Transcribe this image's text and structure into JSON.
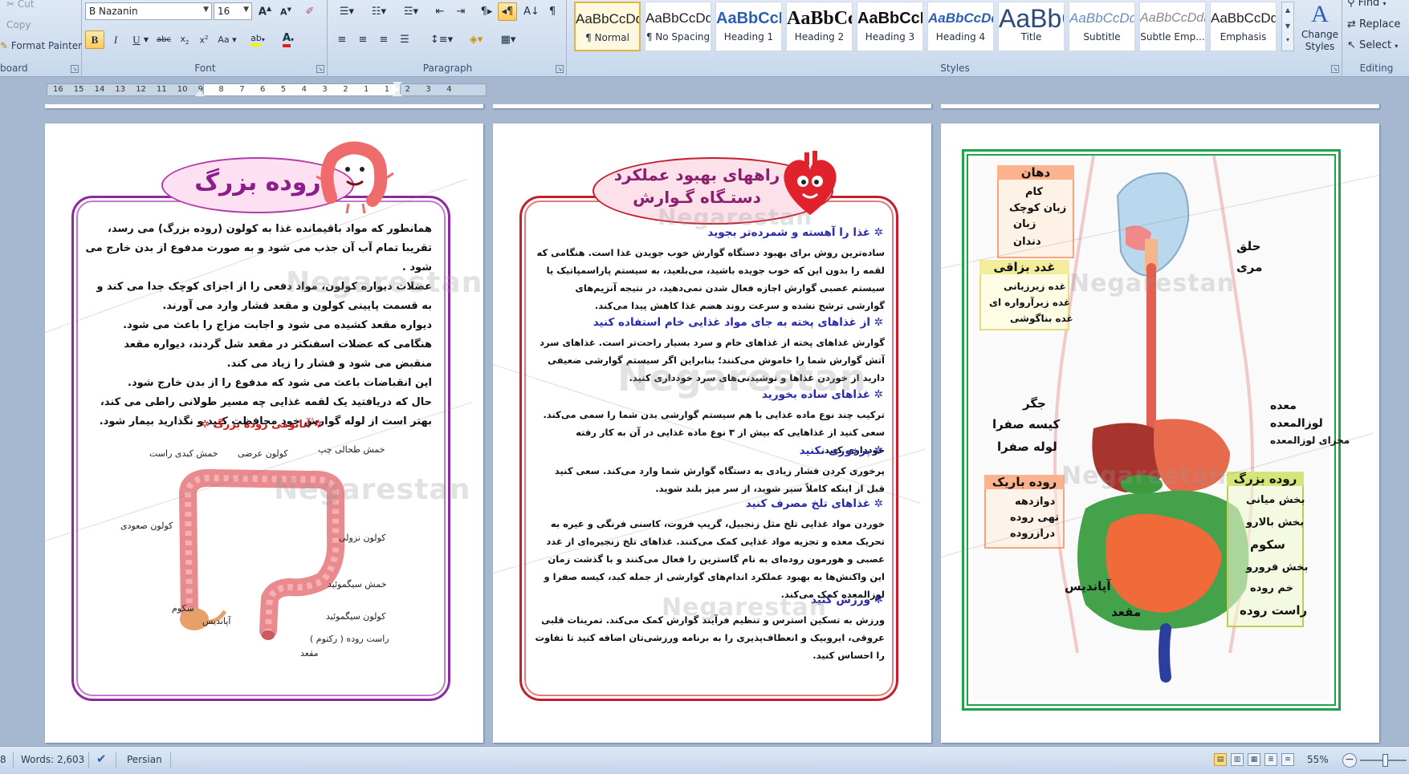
{
  "ribbon": {
    "clipboard": {
      "cut_label": "Cut",
      "copy_label": "Copy",
      "format_painter_label": "Format Painter",
      "group_label": "board"
    },
    "font": {
      "font_name": "B Nazanin",
      "font_size": "16",
      "group_label": "Font"
    },
    "paragraph": {
      "group_label": "Paragraph"
    },
    "styles": {
      "group_label": "Styles",
      "items": [
        {
          "sample": "AaBbCcDdEe",
          "name": "¶ Normal"
        },
        {
          "sample": "AaBbCcDdEe",
          "name": "¶ No Spacing"
        },
        {
          "sample": "AaBbCcDdEe",
          "name": "Heading 1"
        },
        {
          "sample": "AaBbCcDdEe",
          "name": "Heading 2"
        },
        {
          "sample": "AaBbCcDdEe",
          "name": "Heading 3"
        },
        {
          "sample": "AaBbCcDdEe",
          "name": "Heading 4"
        },
        {
          "sample": "AaBbCcDdEe",
          "name": "Title"
        },
        {
          "sample": "AaBbCcDdEe",
          "name": "Subtitle"
        },
        {
          "sample": "AaBbCcDdEe",
          "name": "Subtle Emp..."
        },
        {
          "sample": "AaBbCcDdEe",
          "name": "Emphasis"
        }
      ],
      "change_styles_label": "Change Styles"
    },
    "editing": {
      "find_label": "Find",
      "replace_label": "Replace",
      "select_label": "Select",
      "group_label": "Editing"
    }
  },
  "ruler": {
    "numbers": [
      "16",
      "15",
      "14",
      "13",
      "12",
      "11",
      "10",
      "9",
      "8",
      "7",
      "6",
      "5",
      "4",
      "3",
      "2",
      "1",
      "1",
      "2",
      "3",
      "4"
    ]
  },
  "page1": {
    "title": "روده بزرگ",
    "paragraphs": [
      "همانطور که مواد باقیمانده غذا به کولون (روده بزرگ) می رسد، تقریبا تمام آب آن جذب می شود و به صورت مدفوع از بدن خارج می شود .",
      "عضلات دیواره کولون، مواد دفعی را از اجزای کوچک جدا می کند و به قسمت پایینی کولون و مقعد فشار وارد می آورند.",
      "دیواره مقعد کشیده می شود و اجابت مزاج را باعث می شود.",
      "هنگامی که عضلات اسفنکتر در مقعد شل گردند، دیواره مقعد منقبض می شود و فشار را زیاد می کند.",
      "این انقباضات باعث می شود که مدفوع را از بدن خارج شود.",
      "حال که دریافتید یک لقمه غذایی چه مسیر طولانی راطی می کند، بهتر است از لوله گوارش خود محافظت کنید و نگذارید بیمار شود."
    ],
    "anatomy_heading": "آناتومی روده بزرگ",
    "labels": {
      "splenic": "خمش طحالی چپ",
      "transverse": "کولون عرضی",
      "hepatic": "خمش کبدی راست",
      "ascending": "کولون صعودی",
      "descending": "کولون نزولی",
      "sigmoid_flex": "خمش سیگموئید",
      "cecum": "سکوم",
      "sigmoid": "کولون سیگموئید",
      "appendix": "آپاندیس",
      "rectum": "راست روده ( رکتوم )",
      "anus": "مقعد"
    }
  },
  "page2": {
    "title_line1": "راههای بهبود عملکرد",
    "title_line2": "دستـگاه گـوارش",
    "sections": [
      {
        "heading": "غذا را آهسته و شمرده‌تر بجوید",
        "text": "ساده‌ترین روش برای بهبود دستگاه گوارش خوب جویدن غذا است. هنگامی که لقمه را بدون این که خوب جویده باشید، می‌بلعید، به سیستم پاراسمپاتیک یا سیستم عصبی گوارش اجازه فعال شدن نمی‌دهید، در نتیجه آنزیم‌های گوارشی ترشح نشده و سرعت روند هضم غذا کاهش پیدا می‌کند."
      },
      {
        "heading": "از غذاهای پخته به جای مواد غذایی خام استفاده کنید",
        "text": "گوارش غذاهای پخته از غذاهای خام و سرد بسیار راحت‌تر است. غذاهای سرد آتش گوارش شما را خاموش می‌کنند؛ بنابراین اگر سیستم گوارشی ضعیفی دارید از خوردن غذاها و نوشیدنی‌های سرد خودداری کنید."
      },
      {
        "heading": "غذاهای ساده بخورید",
        "text": "ترکیب چند نوع ماده غذایی با هم سیستم گوارشی بدن شما را سمی می‌کند. سعی کنید از غذاهایی که بیش از ٣ نوع ماده غذایی در آن به کار رفته خودداری کنید."
      },
      {
        "heading": "پرخوری نکنید",
        "text": "پرخوری کردن فشار زیادی به دستگاه گوارش شما وارد می‌کند. سعی کنید قبل از اینکه کاملاً سیر شوید، از سر میز بلند شوید."
      },
      {
        "heading": "غذاهای تلخ مصرف کنید",
        "text": "خوردن مواد غذایی تلخ مثل زنجبیل، گریپ فروت، کاسنی فرنگی و غیره به تحریک معده و تجزیه مواد غذایی کمک می‌کنند. غذاهای تلخ زنجیره‌ای از غدد عصبی و هورمون روده‌ای به نام گاسترین را فعال می‌کنند و با گذشت زمان این واکنش‌ها به بهبود عملکرد اندام‌های گوارشی از جمله کبد، کیسه صفرا و لوزالمعده کمک می‌کند."
      },
      {
        "heading": "ورزش کنید",
        "text": "ورزش به تسکین استرس و تنظیم فرآیند گوارش کمک می‌کند. تمرینات قلبی عروقی، ایروبیک و انعطاف‌پذیری را به برنامه ورزشی‌تان اضافه کنید تا تفاوت را احساس کنید."
      }
    ]
  },
  "page3": {
    "mouth_box": "دهان",
    "mouth_items": [
      "کام",
      "زبان کوچک",
      "زبان",
      "دندان"
    ],
    "salivary_box": "غدد بزاقی",
    "salivary_items": [
      "غده زیرزبانی",
      "غده زیرآرواره ای",
      "غده بناگوشی"
    ],
    "pharynx": "حلق",
    "esophagus": "مری",
    "liver": "جگر",
    "gallbladder": "کیسه صفرا",
    "bile_duct": "لوله صفرا",
    "stomach": "معده",
    "pancreas": "لوزالمعده",
    "pancreatic_duct": "مجرای لوزالمعده",
    "small_intestine_box": "روده باریک",
    "small_intestine_items": [
      "دوازدهه",
      "تهی روده",
      "درازروده"
    ],
    "large_intestine_box": "روده بزرگ",
    "large_intestine_items": [
      "بخش میانی",
      "بخش بالارو",
      "سکوم",
      "بخش فرورو",
      "خم روده",
      "راست روده"
    ],
    "appendix": "آپاندیس",
    "anus": "مقعد"
  },
  "watermark_text": "Negarestan",
  "status": {
    "page_fragment": "8",
    "words": "Words: 2,603",
    "language": "Persian",
    "zoom": "55%"
  },
  "colors": {
    "purple_frame": "#8b2a9c",
    "red_frame": "#c3202e",
    "green_frame": "#1fa34a",
    "blue_heading": "#2a2aa8",
    "red_heading": "#d01818"
  }
}
